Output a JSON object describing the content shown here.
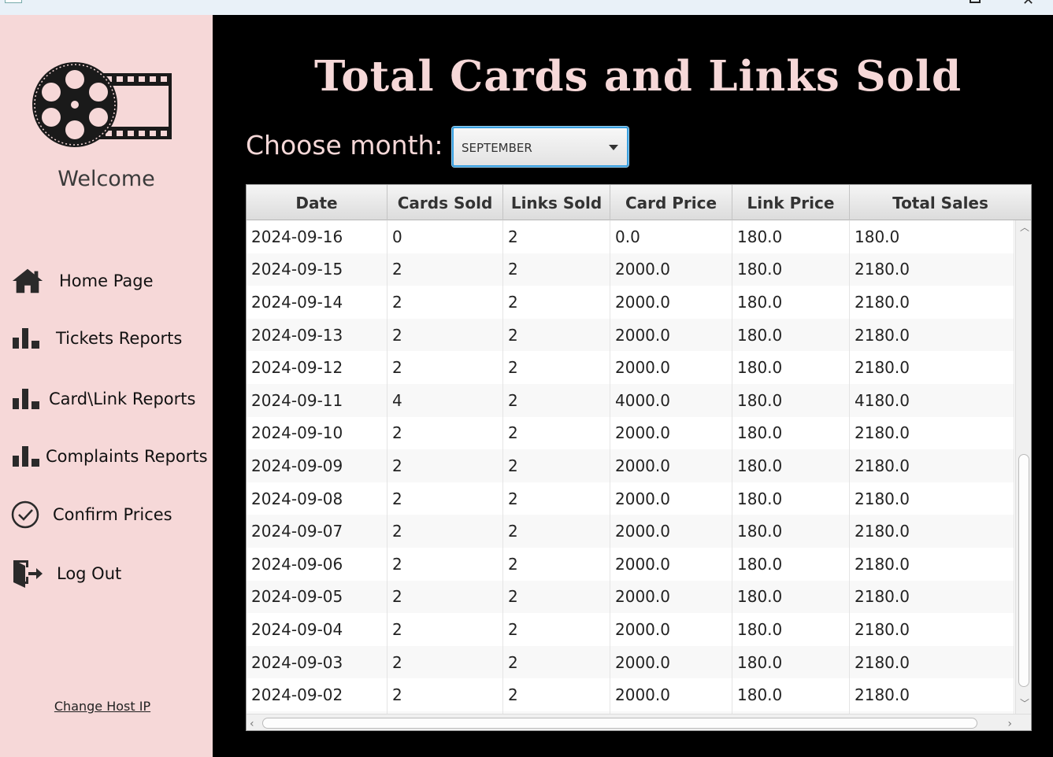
{
  "sidebar": {
    "welcome": "Welcome",
    "items": [
      {
        "label": "Home Page",
        "icon": "home-icon"
      },
      {
        "label": "Tickets Reports",
        "icon": "bar-chart-icon"
      },
      {
        "label": "Card\\Link Reports",
        "icon": "bar-chart-icon"
      },
      {
        "label": "Complaints Reports",
        "icon": "bar-chart-icon"
      },
      {
        "label": "Confirm Prices",
        "icon": "check-circle-icon"
      },
      {
        "label": "Log Out",
        "icon": "logout-icon"
      }
    ],
    "change_host": "Change Host IP"
  },
  "main": {
    "title": "Total Cards and Links Sold",
    "month_label": "Choose month:",
    "month_value": "SEPTEMBER"
  },
  "table": {
    "columns": [
      "Date",
      "Cards Sold",
      "Links Sold",
      "Card Price",
      "Link Price",
      "Total Sales"
    ],
    "rows": [
      [
        "2024-09-16",
        "0",
        "2",
        "0.0",
        "180.0",
        "180.0"
      ],
      [
        "2024-09-15",
        "2",
        "2",
        "2000.0",
        "180.0",
        "2180.0"
      ],
      [
        "2024-09-14",
        "2",
        "2",
        "2000.0",
        "180.0",
        "2180.0"
      ],
      [
        "2024-09-13",
        "2",
        "2",
        "2000.0",
        "180.0",
        "2180.0"
      ],
      [
        "2024-09-12",
        "2",
        "2",
        "2000.0",
        "180.0",
        "2180.0"
      ],
      [
        "2024-09-11",
        "4",
        "2",
        "4000.0",
        "180.0",
        "4180.0"
      ],
      [
        "2024-09-10",
        "2",
        "2",
        "2000.0",
        "180.0",
        "2180.0"
      ],
      [
        "2024-09-09",
        "2",
        "2",
        "2000.0",
        "180.0",
        "2180.0"
      ],
      [
        "2024-09-08",
        "2",
        "2",
        "2000.0",
        "180.0",
        "2180.0"
      ],
      [
        "2024-09-07",
        "2",
        "2",
        "2000.0",
        "180.0",
        "2180.0"
      ],
      [
        "2024-09-06",
        "2",
        "2",
        "2000.0",
        "180.0",
        "2180.0"
      ],
      [
        "2024-09-05",
        "2",
        "2",
        "2000.0",
        "180.0",
        "2180.0"
      ],
      [
        "2024-09-04",
        "2",
        "2",
        "2000.0",
        "180.0",
        "2180.0"
      ],
      [
        "2024-09-03",
        "2",
        "2",
        "2000.0",
        "180.0",
        "2180.0"
      ],
      [
        "2024-09-02",
        "2",
        "2",
        "2000.0",
        "180.0",
        "2180.0"
      ],
      [
        "",
        "",
        "",
        "",
        "",
        ""
      ]
    ]
  },
  "colors": {
    "sidebar_bg": "#f6d8d8",
    "main_bg": "#000000",
    "accent_pink": "#f6d8d8",
    "select_focus": "#3aa0e0"
  }
}
